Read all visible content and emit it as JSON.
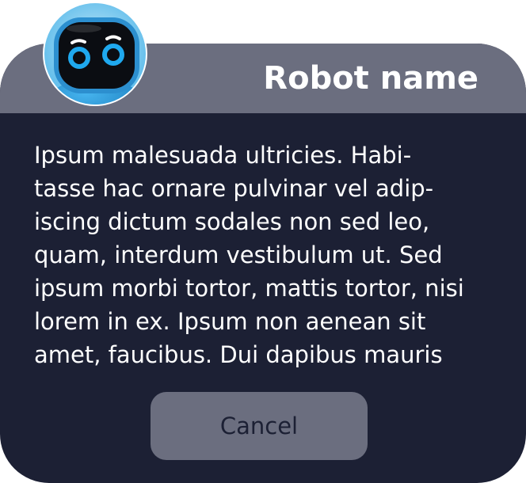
{
  "dialog": {
    "title": "Robot name",
    "avatar_icon": "robot-face-icon",
    "message_lines": [
      "Ipsum malesuada ultricies. Habi-",
      "tasse hac ornare pulvinar vel adip-",
      "iscing dictum sodales non sed leo,",
      "quam, interdum vestibulum ut. Sed",
      "ipsum morbi tortor, mattis tortor, nisi",
      "lorem in ex. Ipsum non aenean sit",
      "amet, faucibus. Dui dapibus mauris"
    ],
    "cancel_label": "Cancel"
  },
  "colors": {
    "dialog_background": "#1c2034",
    "header_background": "#6b6e7f",
    "button_background": "#6b6e7f",
    "accent_eye": "#1fa9ef"
  }
}
